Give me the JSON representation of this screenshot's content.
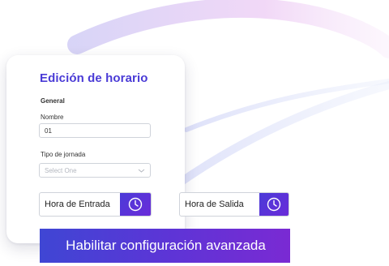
{
  "form": {
    "title": "Edición de horario",
    "section": "General",
    "name_label": "Nombre",
    "name_value": "01",
    "shift_label": "Tipo de jornada",
    "shift_placeholder": "Select One"
  },
  "time": {
    "entry_label": "Hora de Entrada",
    "exit_label": "Hora de Salida"
  },
  "advanced_button": "Habilitar configuración avanzada",
  "colors": {
    "accent": "#4a3bd6",
    "gradient_start": "#3f46d4",
    "gradient_end": "#7a2ad3"
  }
}
